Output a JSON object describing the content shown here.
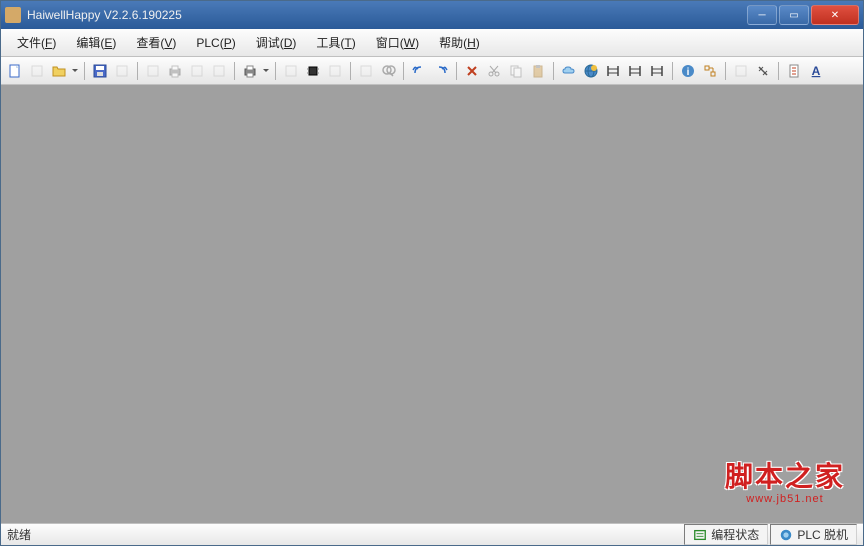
{
  "titlebar": {
    "title": "HaiwellHappy V2.2.6.190225"
  },
  "menu": {
    "items": [
      {
        "label": "文件",
        "key": "F"
      },
      {
        "label": "编辑",
        "key": "E"
      },
      {
        "label": "查看",
        "key": "V"
      },
      {
        "label": "PLC",
        "key": "P"
      },
      {
        "label": "调试",
        "key": "D"
      },
      {
        "label": "工具",
        "key": "T"
      },
      {
        "label": "窗口",
        "key": "W"
      },
      {
        "label": "帮助",
        "key": "H"
      }
    ]
  },
  "toolbar": {
    "buttons": [
      {
        "name": "new-file-icon",
        "type": "new"
      },
      {
        "name": "open-folder-icon",
        "type": "disabled"
      },
      {
        "name": "folder-icon",
        "type": "folder",
        "dropdown": true
      },
      {
        "name": "sep"
      },
      {
        "name": "save-icon",
        "type": "save"
      },
      {
        "name": "export-icon",
        "type": "disabled"
      },
      {
        "name": "sep"
      },
      {
        "name": "doc-icon",
        "type": "disabled"
      },
      {
        "name": "print-icon",
        "type": "print",
        "disabled": true
      },
      {
        "name": "preview-icon",
        "type": "disabled"
      },
      {
        "name": "page-icon",
        "type": "disabled"
      },
      {
        "name": "sep"
      },
      {
        "name": "printer-icon",
        "type": "printer",
        "dropdown": true
      },
      {
        "name": "sep"
      },
      {
        "name": "run-icon",
        "type": "disabled"
      },
      {
        "name": "chip-icon",
        "type": "chip"
      },
      {
        "name": "build-icon",
        "type": "disabled"
      },
      {
        "name": "sep"
      },
      {
        "name": "check-icon",
        "type": "disabled"
      },
      {
        "name": "find-icon",
        "type": "find",
        "disabled": true
      },
      {
        "name": "sep"
      },
      {
        "name": "undo-icon",
        "type": "undo"
      },
      {
        "name": "redo-icon",
        "type": "redo"
      },
      {
        "name": "sep"
      },
      {
        "name": "tool-icon",
        "type": "tool"
      },
      {
        "name": "cut-icon",
        "type": "cut",
        "disabled": true
      },
      {
        "name": "copy-icon",
        "type": "copy",
        "disabled": true
      },
      {
        "name": "paste-icon",
        "type": "paste",
        "disabled": true
      },
      {
        "name": "sep"
      },
      {
        "name": "cloud-icon",
        "type": "cloud"
      },
      {
        "name": "globe-icon",
        "type": "globe"
      },
      {
        "name": "ladder1-icon",
        "type": "ladder"
      },
      {
        "name": "ladder2-icon",
        "type": "ladder"
      },
      {
        "name": "ladder3-icon",
        "type": "ladder"
      },
      {
        "name": "sep"
      },
      {
        "name": "info-icon",
        "type": "info"
      },
      {
        "name": "net-icon",
        "type": "net"
      },
      {
        "name": "sep"
      },
      {
        "name": "branch-icon",
        "type": "disabled"
      },
      {
        "name": "comp-icon",
        "type": "comp"
      },
      {
        "name": "sep"
      },
      {
        "name": "doc2-icon",
        "type": "doc2"
      },
      {
        "name": "text-icon",
        "type": "text"
      }
    ]
  },
  "watermark": {
    "main": "脚本之家",
    "sub": "www.jb51.net"
  },
  "statusbar": {
    "ready": "就绪",
    "mode": "编程状态",
    "plc": "PLC 脱机"
  }
}
